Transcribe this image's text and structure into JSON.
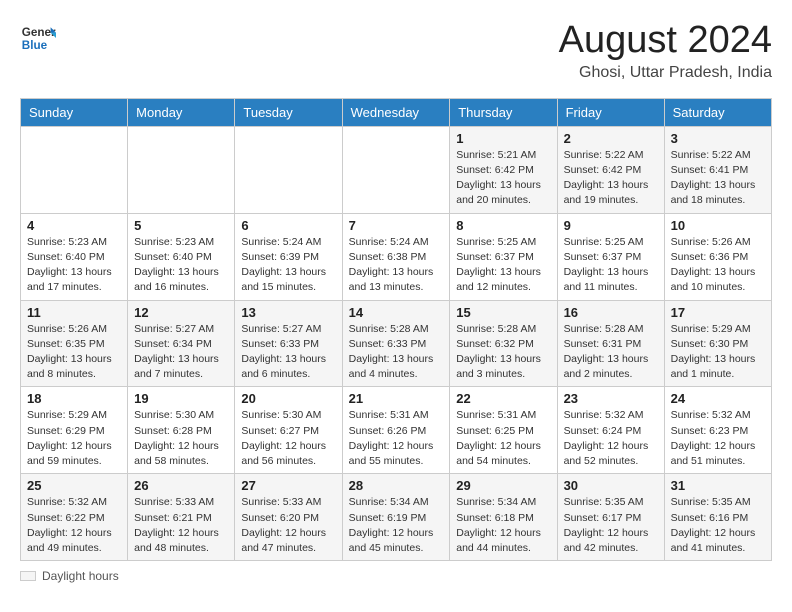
{
  "header": {
    "logo_line1": "General",
    "logo_line2": "Blue",
    "main_title": "August 2024",
    "subtitle": "Ghosi, Uttar Pradesh, India"
  },
  "calendar": {
    "days_of_week": [
      "Sunday",
      "Monday",
      "Tuesday",
      "Wednesday",
      "Thursday",
      "Friday",
      "Saturday"
    ],
    "weeks": [
      [
        {
          "day": "",
          "info": ""
        },
        {
          "day": "",
          "info": ""
        },
        {
          "day": "",
          "info": ""
        },
        {
          "day": "",
          "info": ""
        },
        {
          "day": "1",
          "info": "Sunrise: 5:21 AM\nSunset: 6:42 PM\nDaylight: 13 hours\nand 20 minutes."
        },
        {
          "day": "2",
          "info": "Sunrise: 5:22 AM\nSunset: 6:42 PM\nDaylight: 13 hours\nand 19 minutes."
        },
        {
          "day": "3",
          "info": "Sunrise: 5:22 AM\nSunset: 6:41 PM\nDaylight: 13 hours\nand 18 minutes."
        }
      ],
      [
        {
          "day": "4",
          "info": "Sunrise: 5:23 AM\nSunset: 6:40 PM\nDaylight: 13 hours\nand 17 minutes."
        },
        {
          "day": "5",
          "info": "Sunrise: 5:23 AM\nSunset: 6:40 PM\nDaylight: 13 hours\nand 16 minutes."
        },
        {
          "day": "6",
          "info": "Sunrise: 5:24 AM\nSunset: 6:39 PM\nDaylight: 13 hours\nand 15 minutes."
        },
        {
          "day": "7",
          "info": "Sunrise: 5:24 AM\nSunset: 6:38 PM\nDaylight: 13 hours\nand 13 minutes."
        },
        {
          "day": "8",
          "info": "Sunrise: 5:25 AM\nSunset: 6:37 PM\nDaylight: 13 hours\nand 12 minutes."
        },
        {
          "day": "9",
          "info": "Sunrise: 5:25 AM\nSunset: 6:37 PM\nDaylight: 13 hours\nand 11 minutes."
        },
        {
          "day": "10",
          "info": "Sunrise: 5:26 AM\nSunset: 6:36 PM\nDaylight: 13 hours\nand 10 minutes."
        }
      ],
      [
        {
          "day": "11",
          "info": "Sunrise: 5:26 AM\nSunset: 6:35 PM\nDaylight: 13 hours\nand 8 minutes."
        },
        {
          "day": "12",
          "info": "Sunrise: 5:27 AM\nSunset: 6:34 PM\nDaylight: 13 hours\nand 7 minutes."
        },
        {
          "day": "13",
          "info": "Sunrise: 5:27 AM\nSunset: 6:33 PM\nDaylight: 13 hours\nand 6 minutes."
        },
        {
          "day": "14",
          "info": "Sunrise: 5:28 AM\nSunset: 6:33 PM\nDaylight: 13 hours\nand 4 minutes."
        },
        {
          "day": "15",
          "info": "Sunrise: 5:28 AM\nSunset: 6:32 PM\nDaylight: 13 hours\nand 3 minutes."
        },
        {
          "day": "16",
          "info": "Sunrise: 5:28 AM\nSunset: 6:31 PM\nDaylight: 13 hours\nand 2 minutes."
        },
        {
          "day": "17",
          "info": "Sunrise: 5:29 AM\nSunset: 6:30 PM\nDaylight: 13 hours\nand 1 minute."
        }
      ],
      [
        {
          "day": "18",
          "info": "Sunrise: 5:29 AM\nSunset: 6:29 PM\nDaylight: 12 hours\nand 59 minutes."
        },
        {
          "day": "19",
          "info": "Sunrise: 5:30 AM\nSunset: 6:28 PM\nDaylight: 12 hours\nand 58 minutes."
        },
        {
          "day": "20",
          "info": "Sunrise: 5:30 AM\nSunset: 6:27 PM\nDaylight: 12 hours\nand 56 minutes."
        },
        {
          "day": "21",
          "info": "Sunrise: 5:31 AM\nSunset: 6:26 PM\nDaylight: 12 hours\nand 55 minutes."
        },
        {
          "day": "22",
          "info": "Sunrise: 5:31 AM\nSunset: 6:25 PM\nDaylight: 12 hours\nand 54 minutes."
        },
        {
          "day": "23",
          "info": "Sunrise: 5:32 AM\nSunset: 6:24 PM\nDaylight: 12 hours\nand 52 minutes."
        },
        {
          "day": "24",
          "info": "Sunrise: 5:32 AM\nSunset: 6:23 PM\nDaylight: 12 hours\nand 51 minutes."
        }
      ],
      [
        {
          "day": "25",
          "info": "Sunrise: 5:32 AM\nSunset: 6:22 PM\nDaylight: 12 hours\nand 49 minutes."
        },
        {
          "day": "26",
          "info": "Sunrise: 5:33 AM\nSunset: 6:21 PM\nDaylight: 12 hours\nand 48 minutes."
        },
        {
          "day": "27",
          "info": "Sunrise: 5:33 AM\nSunset: 6:20 PM\nDaylight: 12 hours\nand 47 minutes."
        },
        {
          "day": "28",
          "info": "Sunrise: 5:34 AM\nSunset: 6:19 PM\nDaylight: 12 hours\nand 45 minutes."
        },
        {
          "day": "29",
          "info": "Sunrise: 5:34 AM\nSunset: 6:18 PM\nDaylight: 12 hours\nand 44 minutes."
        },
        {
          "day": "30",
          "info": "Sunrise: 5:35 AM\nSunset: 6:17 PM\nDaylight: 12 hours\nand 42 minutes."
        },
        {
          "day": "31",
          "info": "Sunrise: 5:35 AM\nSunset: 6:16 PM\nDaylight: 12 hours\nand 41 minutes."
        }
      ]
    ]
  },
  "footer": {
    "note": "Daylight hours"
  }
}
